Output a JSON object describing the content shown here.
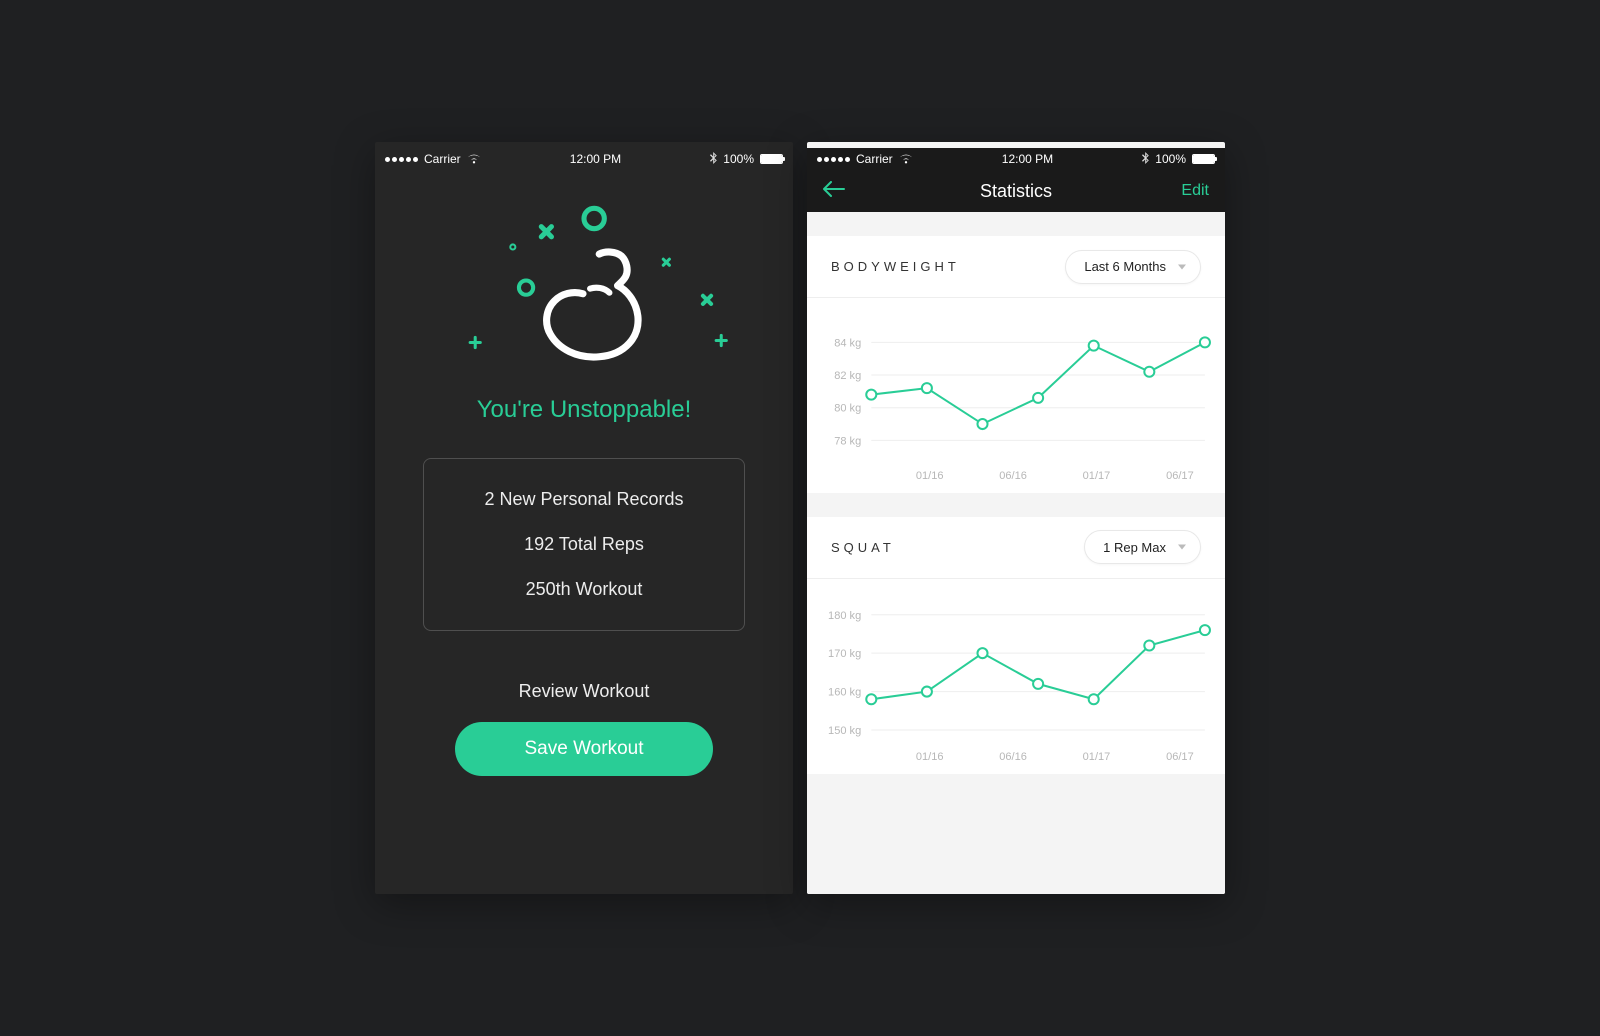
{
  "status_bar": {
    "carrier": "Carrier",
    "time": "12:00 PM",
    "battery_pct": "100%"
  },
  "summary": {
    "headline": "You're Unstoppable!",
    "stats": [
      "2 New Personal Records",
      "192 Total Reps",
      "250th Workout"
    ],
    "review_label": "Review Workout",
    "save_label": "Save Workout"
  },
  "stats_screen": {
    "nav": {
      "title": "Statistics",
      "edit": "Edit"
    },
    "charts": [
      {
        "id": "bodyweight",
        "title": "BODYWEIGHT",
        "selector": "Last 6 Months"
      },
      {
        "id": "squat",
        "title": "SQUAT",
        "selector": "1 Rep Max"
      }
    ]
  },
  "chart_data": [
    {
      "id": "bodyweight",
      "type": "line",
      "title": "BODYWEIGHT",
      "xlabel": "",
      "ylabel": "",
      "y_ticks": [
        78,
        80,
        82,
        84
      ],
      "y_unit": "kg",
      "ylim": [
        77,
        85
      ],
      "x_ticks": [
        "01/16",
        "06/16",
        "01/17",
        "06/17"
      ],
      "x": [
        0,
        1,
        2,
        3,
        4,
        5
      ],
      "values": [
        80.8,
        81.2,
        79.0,
        80.6,
        83.8,
        82.2,
        84.0
      ]
    },
    {
      "id": "squat",
      "type": "line",
      "title": "SQUAT",
      "xlabel": "",
      "ylabel": "",
      "y_ticks": [
        150,
        160,
        170,
        180
      ],
      "y_unit": "kg",
      "ylim": [
        148,
        182
      ],
      "x_ticks": [
        "01/16",
        "06/16",
        "01/17",
        "06/17"
      ],
      "x": [
        0,
        1,
        2,
        3,
        4,
        5
      ],
      "values": [
        158,
        160,
        170,
        162,
        158,
        172,
        176
      ]
    }
  ]
}
